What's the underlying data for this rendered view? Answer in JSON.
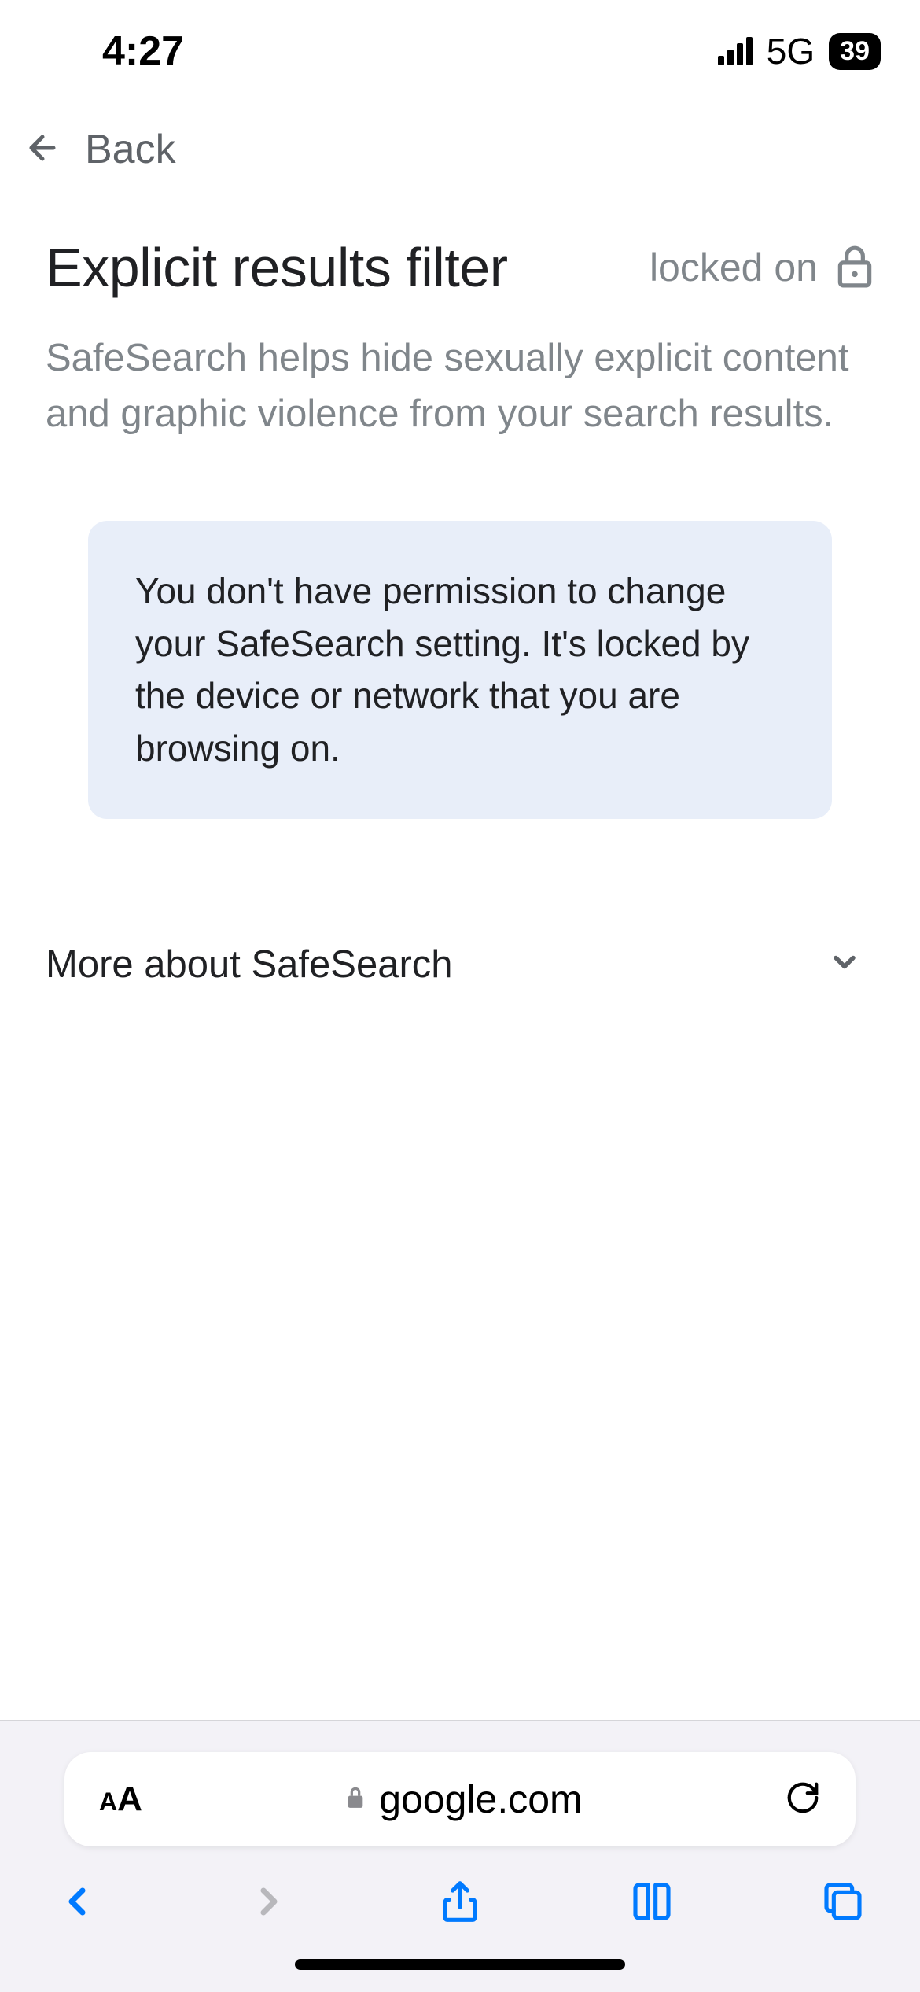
{
  "status_bar": {
    "time": "4:27",
    "network": "5G",
    "battery": "39"
  },
  "nav": {
    "back_label": "Back"
  },
  "page": {
    "title": "Explicit results filter",
    "locked_label": "locked on",
    "description": "SafeSearch helps hide sexually explicit content and graphic violence from your search results.",
    "info_message": "You don't have permission to change your SafeSearch setting. It's locked by the device or network that you are browsing on.",
    "expandable_label": "More about SafeSearch"
  },
  "safari": {
    "url": "google.com"
  }
}
